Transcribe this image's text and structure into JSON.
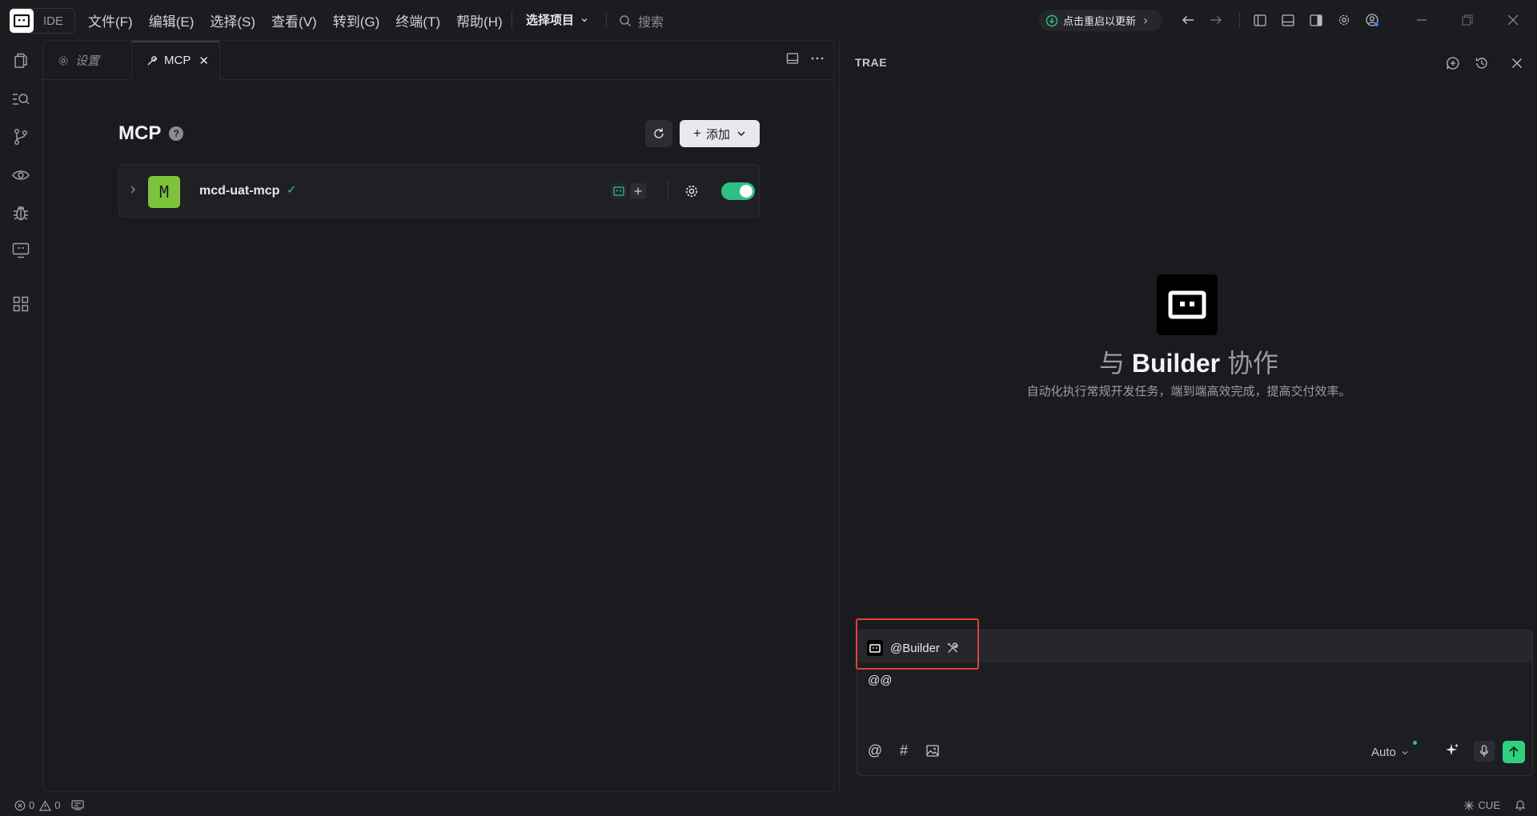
{
  "titlebar": {
    "logo_text": "IDE",
    "menu": [
      "文件(F)",
      "编辑(E)",
      "选择(S)",
      "查看(V)",
      "转到(G)",
      "终端(T)",
      "帮助(H)"
    ],
    "project_label": "选择项目",
    "search_placeholder": "搜索",
    "update_label": "点击重启以更新"
  },
  "activity_bar": {
    "items": [
      "explorer-icon",
      "search-icon",
      "source-control-icon",
      "preview-icon",
      "debug-icon",
      "remote-icon",
      "extensions-icon"
    ]
  },
  "editor": {
    "tabs": [
      {
        "label": "设置",
        "icon": "gear-icon",
        "active": false
      },
      {
        "label": "MCP",
        "icon": "wrench-icon",
        "active": true,
        "close": "✕"
      }
    ],
    "page_title": "MCP",
    "help_mark": "?",
    "add_button": "添加",
    "servers": [
      {
        "avatar_letter": "M",
        "name": "mcd-uat-mcp",
        "status_mark": "✓",
        "enabled": true,
        "avatar_color": "#7cc33b"
      }
    ]
  },
  "chat": {
    "header": "TRAE",
    "title_prefix": "与",
    "title_main": "Builder",
    "title_suffix": "协作",
    "subtitle": "自动化执行常规开发任务，端到端高效完成，提高交付效率。",
    "agent_chip": "@Builder",
    "input_value": "@@",
    "mode": "Auto",
    "tools": [
      "@",
      "#"
    ]
  },
  "statusbar": {
    "errors": "0",
    "warnings": "0",
    "language": "CUE"
  },
  "colors": {
    "accent_green": "#2fbf84",
    "highlight_red": "#e0433a",
    "background": "#1a1b1e"
  }
}
